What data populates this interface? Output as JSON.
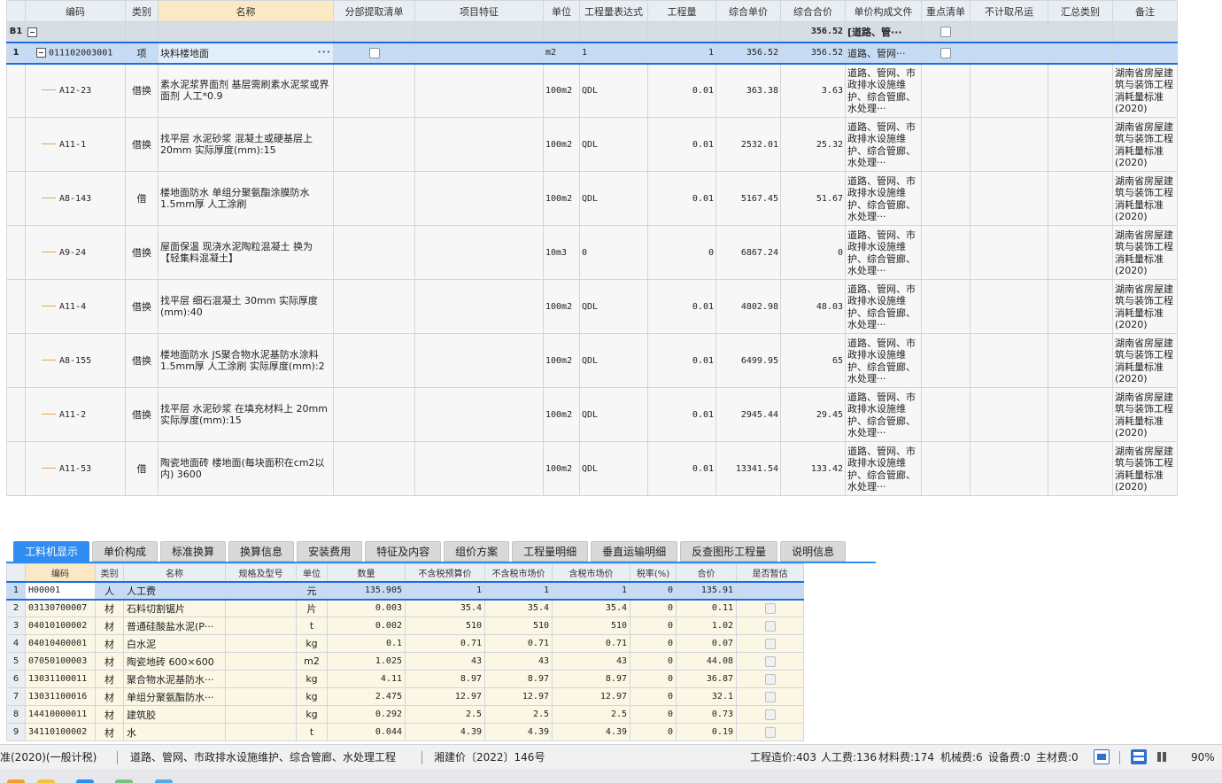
{
  "columns": [
    "编码",
    "类别",
    "名称",
    "分部提取清单",
    "项目特征",
    "单位",
    "工程量表达式",
    "工程量",
    "综合单价",
    "综合合价",
    "单价构成文件",
    "重点清单",
    "不计取吊运",
    "汇总类别",
    "备注"
  ],
  "section": {
    "row": "B1",
    "total": "356.52",
    "cost_file": "[道路、管···"
  },
  "bill": {
    "row": "1",
    "code": "011102003001",
    "type": "项",
    "name": "块料楼地面",
    "more": "···",
    "unit": "m2",
    "expr": "1",
    "qty": "1",
    "unit_price": "356.52",
    "total": "356.52",
    "cost_file": "道路、管网···"
  },
  "quotas": [
    {
      "code": "A12-23",
      "type": "借换",
      "name": "素水泥浆界面剂 基层需刷素水泥浆或界面剂 人工*0.9",
      "unit": "100m2",
      "expr": "QDL",
      "qty": "0.01",
      "unit_price": "363.38",
      "total": "3.63",
      "cost_file": "道路、管网、市政排水设施维护、综合管廊、水处理···",
      "note": "湖南省房屋建筑与装饰工程消耗量标准(2020)"
    },
    {
      "code": "A11-1",
      "type": "借换",
      "name": "找平层 水泥砂浆 混凝土或硬基层上 20mm 实际厚度(mm):15",
      "unit": "100m2",
      "expr": "QDL",
      "qty": "0.01",
      "unit_price": "2532.01",
      "total": "25.32",
      "cost_file": "道路、管网、市政排水设施维护、综合管廊、水处理···",
      "note": "湖南省房屋建筑与装饰工程消耗量标准(2020)"
    },
    {
      "code": "A8-143",
      "type": "借",
      "name": "楼地面防水 单组分聚氨酯涂膜防水 1.5mm厚 人工涂刷",
      "unit": "100m2",
      "expr": "QDL",
      "qty": "0.01",
      "unit_price": "5167.45",
      "total": "51.67",
      "cost_file": "道路、管网、市政排水设施维护、综合管廊、水处理···",
      "note": "湖南省房屋建筑与装饰工程消耗量标准(2020)"
    },
    {
      "code": "A9-24",
      "type": "借换",
      "name": "屋面保温 现浇水泥陶粒混凝土 换为【轻集料混凝土】",
      "unit": "10m3",
      "expr": "0",
      "qty": "0",
      "unit_price": "6867.24",
      "total": "0",
      "cost_file": "道路、管网、市政排水设施维护、综合管廊、水处理···",
      "note": "湖南省房屋建筑与装饰工程消耗量标准(2020)"
    },
    {
      "code": "A11-4",
      "type": "借换",
      "name": "找平层 细石混凝土 30mm 实际厚度(mm):40",
      "unit": "100m2",
      "expr": "QDL",
      "qty": "0.01",
      "unit_price": "4802.98",
      "total": "48.03",
      "cost_file": "道路、管网、市政排水设施维护、综合管廊、水处理···",
      "note": "湖南省房屋建筑与装饰工程消耗量标准(2020)"
    },
    {
      "code": "A8-155",
      "type": "借换",
      "name": "楼地面防水 JS聚合物水泥基防水涂料 1.5mm厚 人工涂刷 实际厚度(mm):2",
      "unit": "100m2",
      "expr": "QDL",
      "qty": "0.01",
      "unit_price": "6499.95",
      "total": "65",
      "cost_file": "道路、管网、市政排水设施维护、综合管廊、水处理···",
      "note": "湖南省房屋建筑与装饰工程消耗量标准(2020)"
    },
    {
      "code": "A11-2",
      "type": "借换",
      "name": "找平层 水泥砂浆 在填充材料上 20mm 实际厚度(mm):15",
      "unit": "100m2",
      "expr": "QDL",
      "qty": "0.01",
      "unit_price": "2945.44",
      "total": "29.45",
      "cost_file": "道路、管网、市政排水设施维护、综合管廊、水处理···",
      "note": "湖南省房屋建筑与装饰工程消耗量标准(2020)"
    },
    {
      "code": "A11-53",
      "type": "借",
      "name": "陶瓷地面砖 楼地面(每块面积在cm2以内) 3600",
      "unit": "100m2",
      "expr": "QDL",
      "qty": "0.01",
      "unit_price": "13341.54",
      "total": "133.42",
      "cost_file": "道路、管网、市政排水设施维护、综合管廊、水处理···",
      "note": "湖南省房屋建筑与装饰工程消耗量标准(2020)"
    }
  ],
  "tabs": [
    "工料机显示",
    "单价构成",
    "标准换算",
    "换算信息",
    "安装费用",
    "特征及内容",
    "组价方案",
    "工程量明细",
    "垂直运输明细",
    "反查图形工程量",
    "说明信息"
  ],
  "res_columns": [
    "编码",
    "类别",
    "名称",
    "规格及型号",
    "单位",
    "数量",
    "不含税预算价",
    "不含税市场价",
    "含税市场价",
    "税率(%)",
    "合价",
    "是否暂估"
  ],
  "resources": [
    {
      "row": "1",
      "code": "H00001",
      "type": "人",
      "name": "人工费",
      "spec": "",
      "unit": "元",
      "qty": "135.905",
      "budget": "1",
      "market": "1",
      "market_tax": "1",
      "rate": "0",
      "total": "135.91"
    },
    {
      "row": "2",
      "code": "03130700007",
      "type": "材",
      "name": "石料切割锯片",
      "spec": "",
      "unit": "片",
      "qty": "0.003",
      "budget": "35.4",
      "market": "35.4",
      "market_tax": "35.4",
      "rate": "0",
      "total": "0.11"
    },
    {
      "row": "3",
      "code": "04010100002",
      "type": "材",
      "name": "普通硅酸盐水泥(P···",
      "spec": "",
      "unit": "t",
      "qty": "0.002",
      "budget": "510",
      "market": "510",
      "market_tax": "510",
      "rate": "0",
      "total": "1.02"
    },
    {
      "row": "4",
      "code": "04010400001",
      "type": "材",
      "name": "白水泥",
      "spec": "",
      "unit": "kg",
      "qty": "0.1",
      "budget": "0.71",
      "market": "0.71",
      "market_tax": "0.71",
      "rate": "0",
      "total": "0.07"
    },
    {
      "row": "5",
      "code": "07050100003",
      "type": "材",
      "name": "陶瓷地砖 600×600",
      "spec": "",
      "unit": "m2",
      "qty": "1.025",
      "budget": "43",
      "market": "43",
      "market_tax": "43",
      "rate": "0",
      "total": "44.08"
    },
    {
      "row": "6",
      "code": "13031100011",
      "type": "材",
      "name": "聚合物水泥基防水···",
      "spec": "",
      "unit": "kg",
      "qty": "4.11",
      "budget": "8.97",
      "market": "8.97",
      "market_tax": "8.97",
      "rate": "0",
      "total": "36.87"
    },
    {
      "row": "7",
      "code": "13031100016",
      "type": "材",
      "name": "单组分聚氨酯防水···",
      "spec": "",
      "unit": "kg",
      "qty": "2.475",
      "budget": "12.97",
      "market": "12.97",
      "market_tax": "12.97",
      "rate": "0",
      "total": "32.1"
    },
    {
      "row": "8",
      "code": "14410000011",
      "type": "材",
      "name": "建筑胶",
      "spec": "",
      "unit": "kg",
      "qty": "0.292",
      "budget": "2.5",
      "market": "2.5",
      "market_tax": "2.5",
      "rate": "0",
      "total": "0.73"
    },
    {
      "row": "9",
      "code": "34110100002",
      "type": "材",
      "name": "水",
      "spec": "",
      "unit": "t",
      "qty": "0.044",
      "budget": "4.39",
      "market": "4.39",
      "market_tax": "4.39",
      "rate": "0",
      "total": "0.19"
    }
  ],
  "status": {
    "standard": "准(2020)(一般计税)",
    "category": "道路、管网、市政排水设施维护、综合管廊、水处理工程",
    "doc": "湘建价〔2022〕146号",
    "cost": "工程造价:403",
    "labor": "人工费:136",
    "material": "材料费:174",
    "machine": "机械费:6",
    "equipment": "设备费:0",
    "main_material": "主材费:0",
    "zoom": "90%"
  },
  "colors": {
    "accent": "#2f8cf0",
    "selected_row": "#c7dcf4",
    "header": "#e9eef3",
    "name_header": "#fbe8c4",
    "res_cell": "#fbf7e4"
  }
}
